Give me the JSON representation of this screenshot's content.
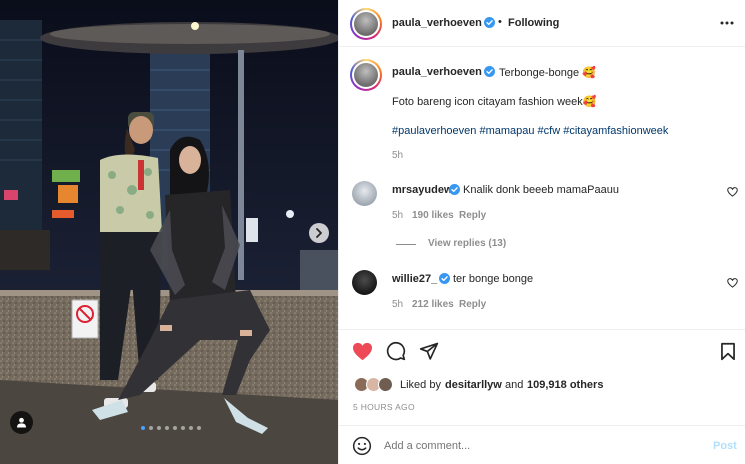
{
  "header": {
    "username": "paula_verhoeven",
    "separator": "•",
    "follow_status": "Following",
    "more_icon": "more-horizontal-icon"
  },
  "caption": {
    "username": "paula_verhoeven",
    "title": "Terbonge-bonge 🥰",
    "body": "Foto bareng icon citayam fashion week🥰",
    "hashtags": "#paulaverhoeven #mamapau #cfw #citayamfashionweek",
    "time": "5h"
  },
  "comments": [
    {
      "username": "mrsayudewi",
      "text": "Knalik donk beeeb mamaPaauu",
      "time": "5h",
      "likes": "190 likes",
      "reply_label": "Reply",
      "view_replies": "View replies (13)"
    },
    {
      "username": "willie27_",
      "text": "ter bonge bonge",
      "time": "5h",
      "likes": "212 likes",
      "reply_label": "Reply"
    }
  ],
  "actions": {
    "like_icon": "heart-filled-icon",
    "comment_icon": "comment-icon",
    "share_icon": "send-icon",
    "save_icon": "bookmark-icon",
    "liked_color": "#ed4956"
  },
  "likes": {
    "prefix": "Liked by",
    "liked_by_user": "desitarllyw",
    "connector": "and",
    "others": "109,918 others"
  },
  "post_time": "5 HOURS AGO",
  "add_comment": {
    "placeholder": "Add a comment...",
    "post_label": "Post",
    "emoji_icon": "emoji-icon"
  },
  "carousel": {
    "total_slides": 8,
    "active_slide": 1,
    "next_icon": "chevron-right-icon",
    "tag_icon": "user-tag-icon"
  },
  "colors": {
    "link": "#00376b",
    "verified": "#3897f0",
    "follow": "#262626",
    "post_disabled": "#b2dffc"
  }
}
